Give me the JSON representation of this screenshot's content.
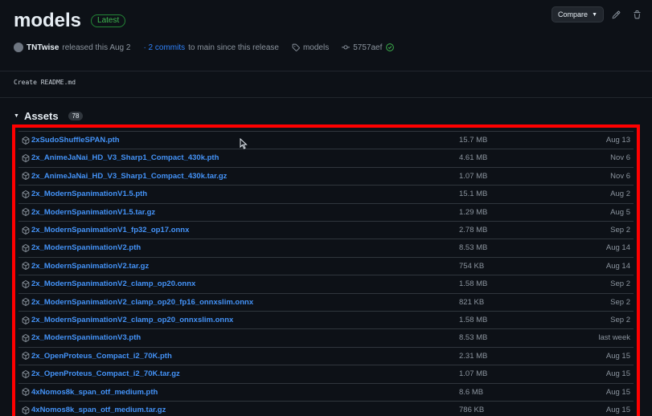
{
  "release": {
    "title": "models",
    "badge": "Latest",
    "author": "TNTwise",
    "released_text": "released this Aug 2",
    "commits_link": "· 2 commits",
    "commits_suffix": "to main since this release",
    "tag": "models",
    "commit": "5757aef",
    "body": "Create README.md"
  },
  "actions": {
    "compare_label": "Compare"
  },
  "assets": {
    "title": "Assets",
    "count": "78",
    "items": [
      {
        "name": "2xSudoShuffleSPAN.pth",
        "size": "15.7 MB",
        "date": "Aug 13"
      },
      {
        "name": "2x_AnimeJaNai_HD_V3_Sharp1_Compact_430k.pth",
        "size": "4.61 MB",
        "date": "Nov 6"
      },
      {
        "name": "2x_AnimeJaNai_HD_V3_Sharp1_Compact_430k.tar.gz",
        "size": "1.07 MB",
        "date": "Nov 6"
      },
      {
        "name": "2x_ModernSpanimationV1.5.pth",
        "size": "15.1 MB",
        "date": "Aug 2"
      },
      {
        "name": "2x_ModernSpanimationV1.5.tar.gz",
        "size": "1.29 MB",
        "date": "Aug 5"
      },
      {
        "name": "2x_ModernSpanimationV1_fp32_op17.onnx",
        "size": "2.78 MB",
        "date": "Sep 2"
      },
      {
        "name": "2x_ModernSpanimationV2.pth",
        "size": "8.53 MB",
        "date": "Aug 14"
      },
      {
        "name": "2x_ModernSpanimationV2.tar.gz",
        "size": "754 KB",
        "date": "Aug 14"
      },
      {
        "name": "2x_ModernSpanimationV2_clamp_op20.onnx",
        "size": "1.58 MB",
        "date": "Sep 2"
      },
      {
        "name": "2x_ModernSpanimationV2_clamp_op20_fp16_onnxslim.onnx",
        "size": "821 KB",
        "date": "Sep 2"
      },
      {
        "name": "2x_ModernSpanimationV2_clamp_op20_onnxslim.onnx",
        "size": "1.58 MB",
        "date": "Sep 2"
      },
      {
        "name": "2x_ModernSpanimationV3.pth",
        "size": "8.53 MB",
        "date": "last week"
      },
      {
        "name": "2x_OpenProteus_Compact_i2_70K.pth",
        "size": "2.31 MB",
        "date": "Aug 15"
      },
      {
        "name": "2x_OpenProteus_Compact_i2_70K.tar.gz",
        "size": "1.07 MB",
        "date": "Aug 15"
      },
      {
        "name": "4xNomos8k_span_otf_medium.pth",
        "size": "8.6 MB",
        "date": "Aug 15"
      },
      {
        "name": "4xNomos8k_span_otf_medium.tar.gz",
        "size": "786 KB",
        "date": "Aug 15"
      }
    ]
  },
  "colors": {
    "background": "#0d1117",
    "link": "#4493f8",
    "highlight": "#ff0000",
    "badge_green": "#3fb950"
  }
}
